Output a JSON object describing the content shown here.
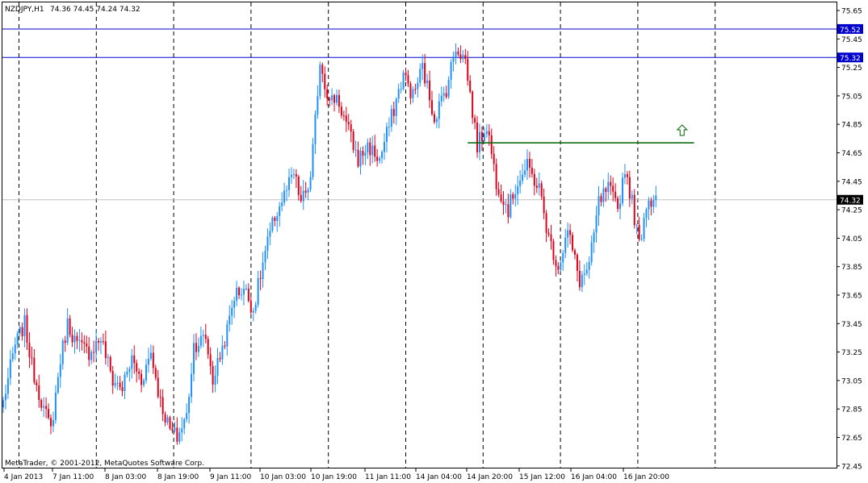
{
  "header": {
    "symbol": "NZDJPY,H1",
    "ohlc": "74.36 74.45 74.24 74.32"
  },
  "footer": {
    "copyright": "MetaTrader, © 2001-2012, MetaQuotes Software Corp."
  },
  "chart_data": {
    "type": "candlestick",
    "title": "NZDJPY,H1",
    "ylim": [
      72.4,
      75.7
    ],
    "y_ticks": [
      "75.65",
      "75.45",
      "75.25",
      "75.05",
      "74.85",
      "74.65",
      "74.45",
      "74.25",
      "74.05",
      "73.85",
      "73.65",
      "73.45",
      "73.25",
      "73.05",
      "72.85",
      "72.65",
      "72.45"
    ],
    "x_ticks": [
      "4 Jan 2013",
      "7 Jan 11:00",
      "8 Jan 03:00",
      "8 Jan 19:00",
      "9 Jan 11:00",
      "10 Jan 03:00",
      "10 Jan 19:00",
      "11 Jan 11:00",
      "14 Jan 04:00",
      "14 Jan 20:00",
      "15 Jan 12:00",
      "16 Jan 04:00",
      "16 Jan 20:00"
    ],
    "horizontal_levels": [
      {
        "value": "75.52",
        "color": "#0000cd"
      },
      {
        "value": "75.32",
        "color": "#0000cd"
      }
    ],
    "current_price": {
      "value": "74.32",
      "color": "#c0c0c0"
    },
    "trendline": {
      "from_bar": 195,
      "to_bar": 290,
      "value": 74.72,
      "color": "#006400"
    },
    "arrow": {
      "bar": 285,
      "value": 74.8,
      "icon": "up-arrow-icon",
      "color": "#006400"
    },
    "colors": {
      "bull": "#1e90ff",
      "bear": "#e0001a"
    },
    "series": [
      {
        "name": "",
        "anchors": [
          [
            0,
            72.9
          ],
          [
            5,
            73.3
          ],
          [
            9,
            73.45
          ],
          [
            12,
            73.15
          ],
          [
            17,
            72.85
          ],
          [
            20,
            72.7
          ],
          [
            24,
            73.2
          ],
          [
            27,
            73.45
          ],
          [
            31,
            73.3
          ],
          [
            36,
            73.25
          ],
          [
            41,
            73.35
          ],
          [
            46,
            73.05
          ],
          [
            50,
            73.0
          ],
          [
            54,
            73.2
          ],
          [
            58,
            73.05
          ],
          [
            62,
            73.25
          ],
          [
            66,
            72.9
          ],
          [
            70,
            72.7
          ],
          [
            73,
            72.65
          ],
          [
            77,
            72.8
          ],
          [
            80,
            73.3
          ],
          [
            85,
            73.35
          ],
          [
            88,
            73.05
          ],
          [
            94,
            73.4
          ],
          [
            97,
            73.65
          ],
          [
            101,
            73.7
          ],
          [
            105,
            73.55
          ],
          [
            110,
            73.95
          ],
          [
            114,
            74.2
          ],
          [
            118,
            74.35
          ],
          [
            122,
            74.5
          ],
          [
            125,
            74.3
          ],
          [
            129,
            74.45
          ],
          [
            133,
            75.3
          ],
          [
            137,
            75.0
          ],
          [
            140,
            75.05
          ],
          [
            144,
            74.85
          ],
          [
            149,
            74.6
          ],
          [
            153,
            74.7
          ],
          [
            158,
            74.6
          ],
          [
            163,
            74.9
          ],
          [
            168,
            75.2
          ],
          [
            172,
            75.05
          ],
          [
            176,
            75.25
          ],
          [
            181,
            74.9
          ],
          [
            186,
            75.1
          ],
          [
            190,
            75.4
          ],
          [
            194,
            75.3
          ],
          [
            199,
            74.7
          ],
          [
            203,
            74.85
          ],
          [
            207,
            74.45
          ],
          [
            212,
            74.25
          ],
          [
            216,
            74.45
          ],
          [
            220,
            74.55
          ],
          [
            225,
            74.4
          ],
          [
            229,
            74.05
          ],
          [
            233,
            73.85
          ],
          [
            237,
            74.1
          ],
          [
            242,
            73.75
          ],
          [
            246,
            73.85
          ],
          [
            250,
            74.3
          ],
          [
            254,
            74.4
          ],
          [
            258,
            74.25
          ],
          [
            261,
            74.55
          ],
          [
            264,
            74.3
          ],
          [
            267,
            74.0
          ],
          [
            270,
            74.3
          ],
          [
            274,
            74.35
          ]
        ]
      }
    ]
  }
}
